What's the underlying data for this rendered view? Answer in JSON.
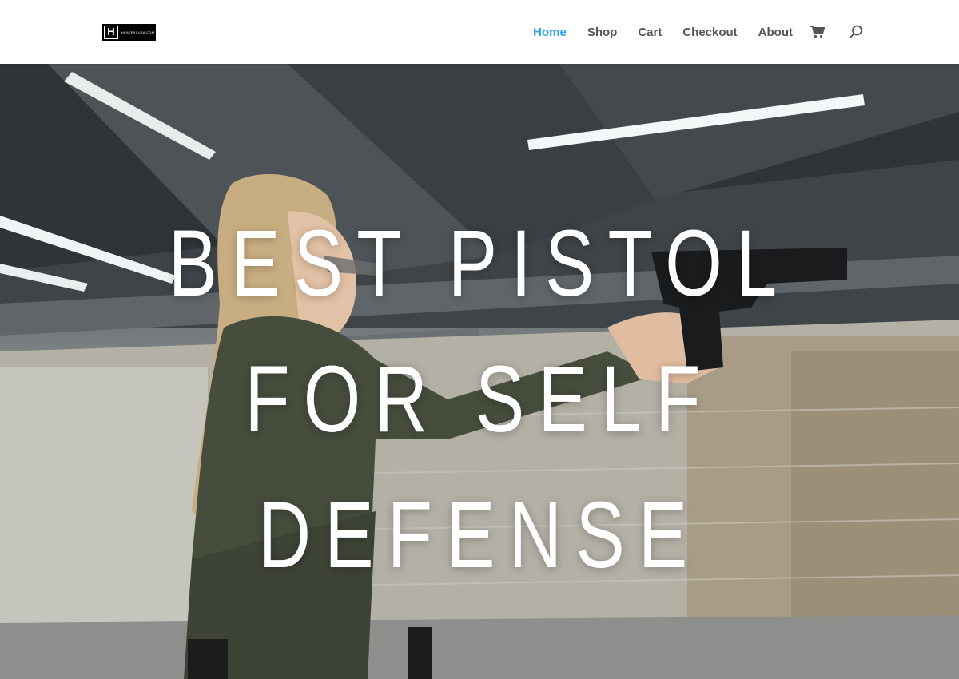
{
  "logo": {
    "letter": "H",
    "text": "HEATERSUSA.COM"
  },
  "nav": {
    "items": [
      {
        "label": "Home",
        "active": true
      },
      {
        "label": "Shop",
        "active": false
      },
      {
        "label": "Cart",
        "active": false
      },
      {
        "label": "Checkout",
        "active": false
      },
      {
        "label": "About",
        "active": false
      }
    ],
    "cart_icon": "shopping-cart-icon",
    "search_icon": "search-icon"
  },
  "hero": {
    "title_lines": [
      "BEST PISTOL",
      "FOR SELF",
      "DEFENSE"
    ],
    "image": "woman-shooting-pistol-at-indoor-range"
  },
  "colors": {
    "accent": "#2ea3f2",
    "nav_text": "#555555",
    "header_bg": "#ffffff",
    "hero_text": "#ffffff"
  }
}
